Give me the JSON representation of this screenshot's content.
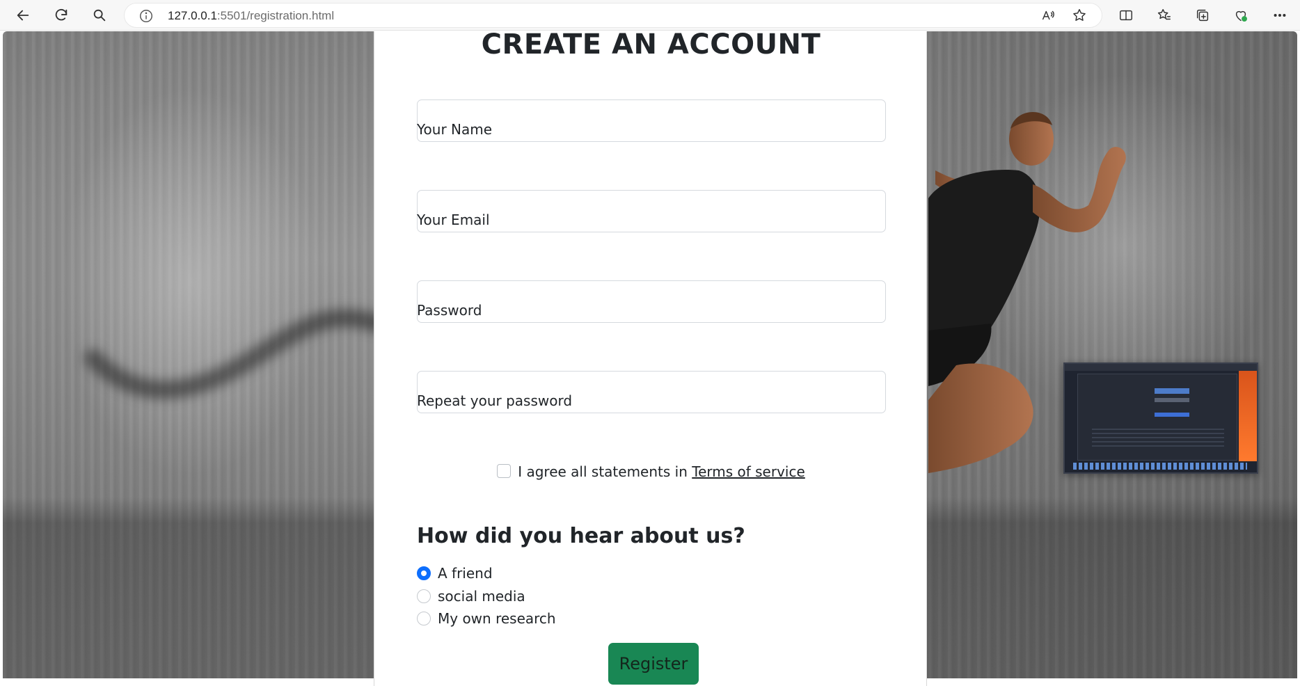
{
  "browser": {
    "url_host": "127.0.0.1",
    "url_path": ":5501/registration.html"
  },
  "form": {
    "title": "CREATE AN ACCOUNT",
    "fields": [
      {
        "label": "Your Name",
        "value": ""
      },
      {
        "label": "Your Email",
        "value": ""
      },
      {
        "label": "Password",
        "value": ""
      },
      {
        "label": "Repeat your password",
        "value": ""
      }
    ],
    "agree_text": "I agree all statements in ",
    "terms_link": "Terms of service",
    "agree_checked": false,
    "hear_heading": "How did you hear about us?",
    "options": [
      {
        "label": "A friend",
        "selected": true
      },
      {
        "label": "social media",
        "selected": false
      },
      {
        "label": "My own research",
        "selected": false
      }
    ],
    "register_label": "Register"
  },
  "colors": {
    "accent_blue": "#0d6efd",
    "register_green": "#198754"
  }
}
